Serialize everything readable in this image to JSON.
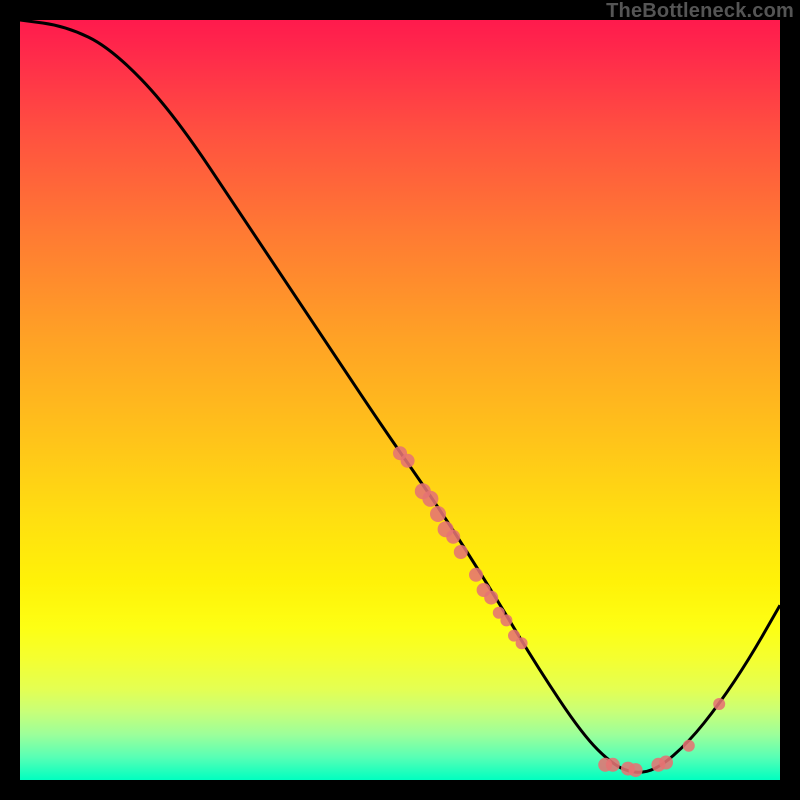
{
  "watermark": "TheBottleneck.com",
  "chart_data": {
    "type": "line",
    "title": "",
    "xlabel": "",
    "ylabel": "",
    "xlim": [
      0,
      100
    ],
    "ylim": [
      0,
      100
    ],
    "grid": false,
    "legend": false,
    "curve": [
      {
        "x": 0,
        "y": 100
      },
      {
        "x": 6,
        "y": 99.2
      },
      {
        "x": 12,
        "y": 96.3
      },
      {
        "x": 20,
        "y": 88
      },
      {
        "x": 30,
        "y": 73
      },
      {
        "x": 40,
        "y": 58
      },
      {
        "x": 48,
        "y": 46
      },
      {
        "x": 55,
        "y": 36
      },
      {
        "x": 62,
        "y": 25
      },
      {
        "x": 68,
        "y": 15
      },
      {
        "x": 74,
        "y": 6
      },
      {
        "x": 78,
        "y": 2
      },
      {
        "x": 81,
        "y": 0.8
      },
      {
        "x": 84,
        "y": 1.5
      },
      {
        "x": 88,
        "y": 5
      },
      {
        "x": 92,
        "y": 10
      },
      {
        "x": 96,
        "y": 16
      },
      {
        "x": 100,
        "y": 23
      }
    ],
    "points": [
      {
        "x": 50,
        "y": 43,
        "r": 7
      },
      {
        "x": 51,
        "y": 42,
        "r": 7
      },
      {
        "x": 53,
        "y": 38,
        "r": 8
      },
      {
        "x": 54,
        "y": 37,
        "r": 8
      },
      {
        "x": 55,
        "y": 35,
        "r": 8
      },
      {
        "x": 56,
        "y": 33,
        "r": 8
      },
      {
        "x": 57,
        "y": 32,
        "r": 7
      },
      {
        "x": 58,
        "y": 30,
        "r": 7
      },
      {
        "x": 60,
        "y": 27,
        "r": 7
      },
      {
        "x": 61,
        "y": 25,
        "r": 7
      },
      {
        "x": 62,
        "y": 24,
        "r": 7
      },
      {
        "x": 63,
        "y": 22,
        "r": 6
      },
      {
        "x": 64,
        "y": 21,
        "r": 6
      },
      {
        "x": 65,
        "y": 19,
        "r": 6
      },
      {
        "x": 66,
        "y": 18,
        "r": 6
      },
      {
        "x": 77,
        "y": 2,
        "r": 7
      },
      {
        "x": 78,
        "y": 2,
        "r": 7
      },
      {
        "x": 80,
        "y": 1.5,
        "r": 7
      },
      {
        "x": 81,
        "y": 1.3,
        "r": 7
      },
      {
        "x": 84,
        "y": 2,
        "r": 7
      },
      {
        "x": 85,
        "y": 2.3,
        "r": 7
      },
      {
        "x": 88,
        "y": 4.5,
        "r": 6
      },
      {
        "x": 92,
        "y": 10,
        "r": 6
      }
    ]
  }
}
